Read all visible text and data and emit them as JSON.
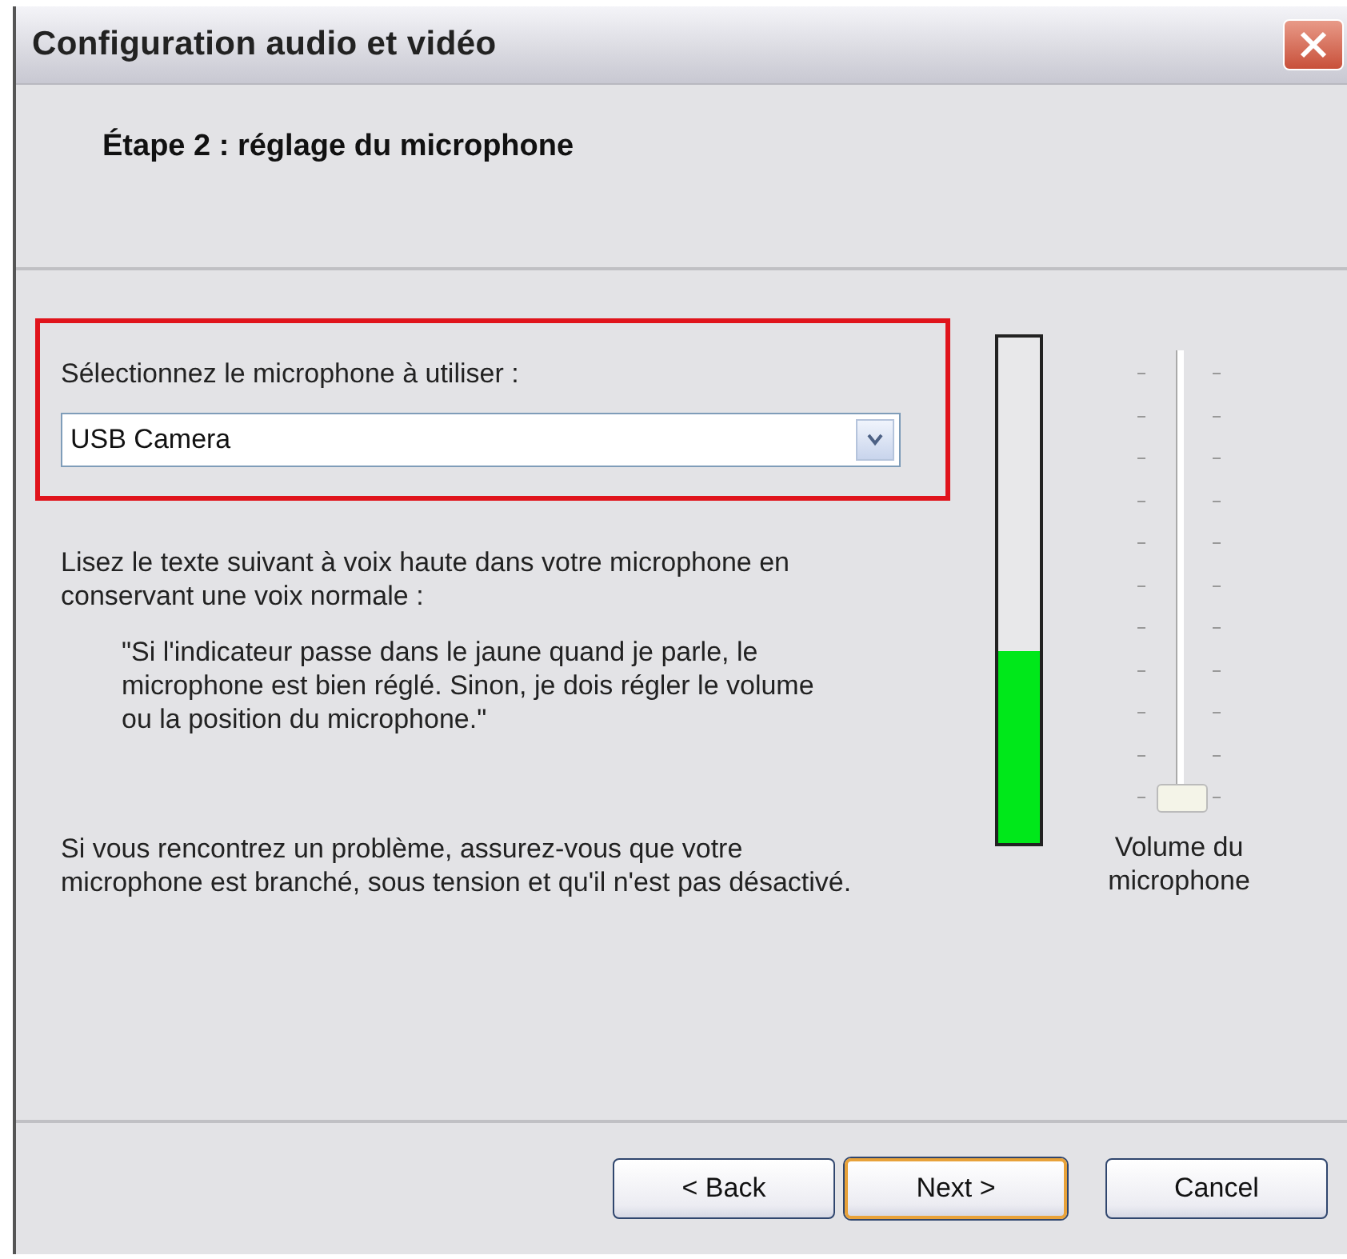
{
  "window": {
    "title": "Configuration audio et vidéo"
  },
  "header": {
    "step": "Étape 2 : réglage du microphone"
  },
  "microphone": {
    "label": "Sélectionnez le microphone à utiliser :",
    "value": "USB Camera",
    "highlighted": true
  },
  "instructions": "Lisez le texte suivant à voix haute dans votre microphone en conservant une voix normale :",
  "quote": "\"Si l'indicateur passe dans le jaune quand je parle, le microphone est bien réglé. Sinon, je dois régler le volume ou la position du microphone.\"",
  "help": "Si vous rencontrez un problème, assurez-vous que votre microphone est branché, sous tension et qu'il n'est pas désactivé.",
  "meter": {
    "level": 0.38
  },
  "volume": {
    "label": "Volume du microphone",
    "level": 0
  },
  "buttons": [
    {
      "label": "< Back",
      "default": false
    },
    {
      "label": "Next >",
      "default": true
    },
    {
      "label": "Cancel",
      "default": false
    }
  ]
}
